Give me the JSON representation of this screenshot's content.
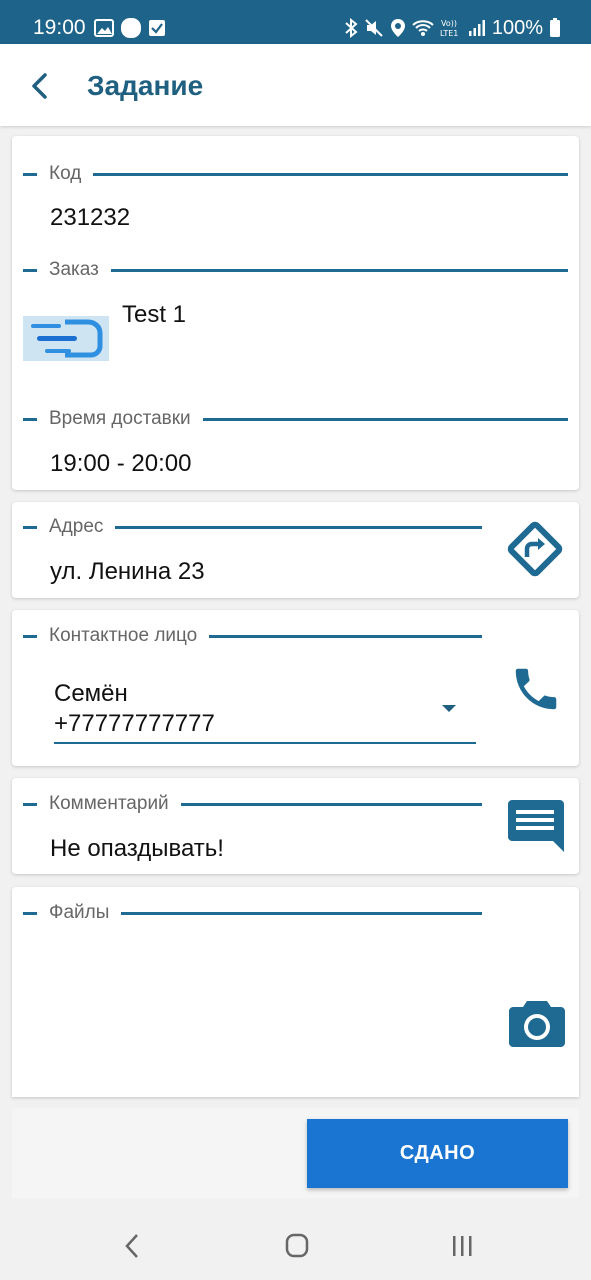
{
  "status_bar": {
    "time": "19:00",
    "battery": "100%",
    "icons_left": [
      "image-icon",
      "circle-icon",
      "checkbox-icon"
    ],
    "icons_right": [
      "bluetooth-icon",
      "mute-icon",
      "location-icon",
      "wifi-icon",
      "volte-icon",
      "signal-icon",
      "battery-icon"
    ]
  },
  "header": {
    "title": "Задание",
    "back_icon": "chevron-left-icon"
  },
  "task": {
    "code_label": "Код",
    "code_value": "231232",
    "order_label": "Заказ",
    "order_name": "Test 1",
    "order_thumbnail_icon": "delivery-logo-icon",
    "delivery_time_label": "Время доставки",
    "delivery_time_value": "19:00 - 20:00"
  },
  "address": {
    "label": "Адрес",
    "value": "ул. Ленина 23",
    "icon": "directions-icon"
  },
  "contact": {
    "label": "Контактное лицо",
    "selected_name": "Семён",
    "selected_phone": "+77777777777",
    "icon": "phone-icon"
  },
  "comment": {
    "label": "Комментарий",
    "value": "Не опаздывать!",
    "icon": "message-icon"
  },
  "files": {
    "label": "Файлы",
    "icon": "camera-icon"
  },
  "actions": {
    "done_label": "СДАНО"
  },
  "colors": {
    "status_bar": "#1e6389",
    "accent": "#1f6a92",
    "title": "#1f5f80",
    "button": "#1a75d2"
  }
}
